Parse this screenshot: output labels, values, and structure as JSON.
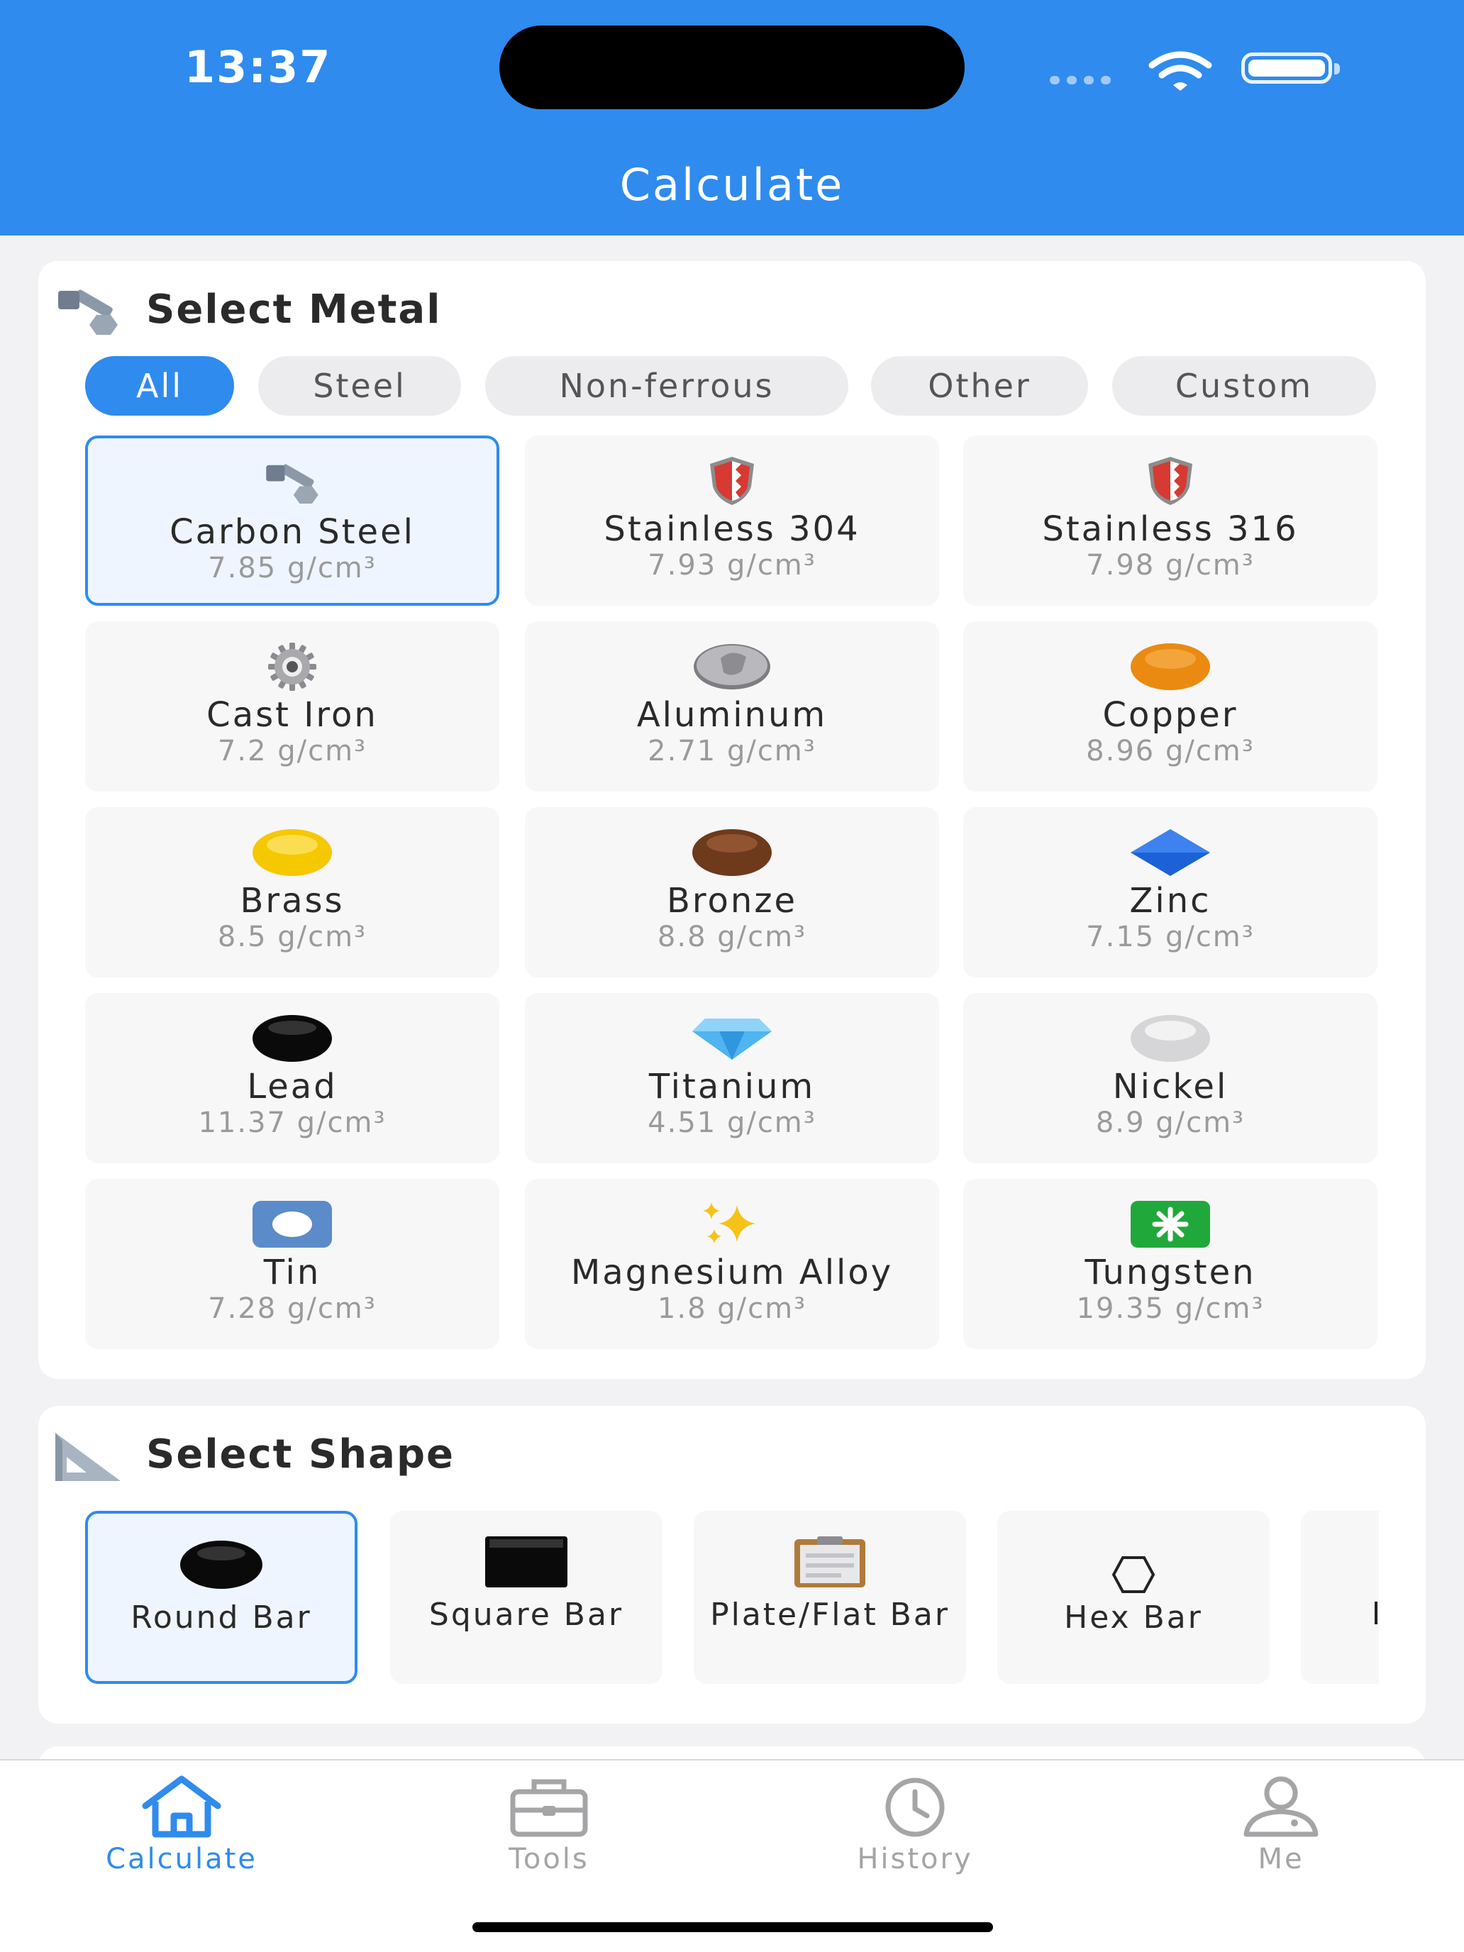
{
  "status_bar": {
    "time": "13:37"
  },
  "header": {
    "title": "Calculate"
  },
  "metal_section": {
    "title": "Select Metal",
    "filters": [
      "All",
      "Steel",
      "Non-ferrous",
      "Other",
      "Custom"
    ],
    "selected_filter": "All",
    "metals": [
      {
        "name": "Carbon Steel",
        "density": "7.85 g/cm³",
        "icon": "nut-and-bolt-icon",
        "selected": true
      },
      {
        "name": "Stainless 304",
        "density": "7.93 g/cm³",
        "icon": "shield-icon"
      },
      {
        "name": "Stainless 316",
        "density": "7.98 g/cm³",
        "icon": "shield-icon"
      },
      {
        "name": "Cast Iron",
        "density": "7.2 g/cm³",
        "icon": "gear-icon"
      },
      {
        "name": "Aluminum",
        "density": "2.71 g/cm³",
        "icon": "coin-icon"
      },
      {
        "name": "Copper",
        "density": "8.96 g/cm³",
        "icon": "orange-circle-icon"
      },
      {
        "name": "Brass",
        "density": "8.5 g/cm³",
        "icon": "yellow-circle-icon"
      },
      {
        "name": "Bronze",
        "density": "8.8 g/cm³",
        "icon": "brown-circle-icon"
      },
      {
        "name": "Zinc",
        "density": "7.15 g/cm³",
        "icon": "blue-diamond-icon"
      },
      {
        "name": "Lead",
        "density": "11.37 g/cm³",
        "icon": "black-circle-icon"
      },
      {
        "name": "Titanium",
        "density": "4.51 g/cm³",
        "icon": "gem-icon"
      },
      {
        "name": "Nickel",
        "density": "8.9 g/cm³",
        "icon": "white-circle-icon"
      },
      {
        "name": "Tin",
        "density": "7.28 g/cm³",
        "icon": "record-button-icon"
      },
      {
        "name": "Magnesium Alloy",
        "density": "1.8 g/cm³",
        "icon": "sparkles-icon"
      },
      {
        "name": "Tungsten",
        "density": "19.35 g/cm³",
        "icon": "eight-spoked-asterisk-icon"
      }
    ]
  },
  "shape_section": {
    "title": "Select Shape",
    "shapes": [
      {
        "name": "Round Bar",
        "icon": "black-circle-icon",
        "selected": true
      },
      {
        "name": "Square Bar",
        "icon": "black-square-icon"
      },
      {
        "name": "Plate/Flat Bar",
        "icon": "clipboard-icon"
      },
      {
        "name": "Hex Bar",
        "icon": "hexagon-icon"
      }
    ]
  },
  "tab_bar": {
    "tabs": [
      {
        "label": "Calculate",
        "icon": "home-icon",
        "active": true
      },
      {
        "label": "Tools",
        "icon": "toolbox-icon"
      },
      {
        "label": "History",
        "icon": "clock-icon"
      },
      {
        "label": "Me",
        "icon": "person-icon"
      }
    ]
  },
  "colors": {
    "accent": "#2f8bee",
    "background": "#f2f2f4",
    "tile": "#f7f7f8"
  }
}
